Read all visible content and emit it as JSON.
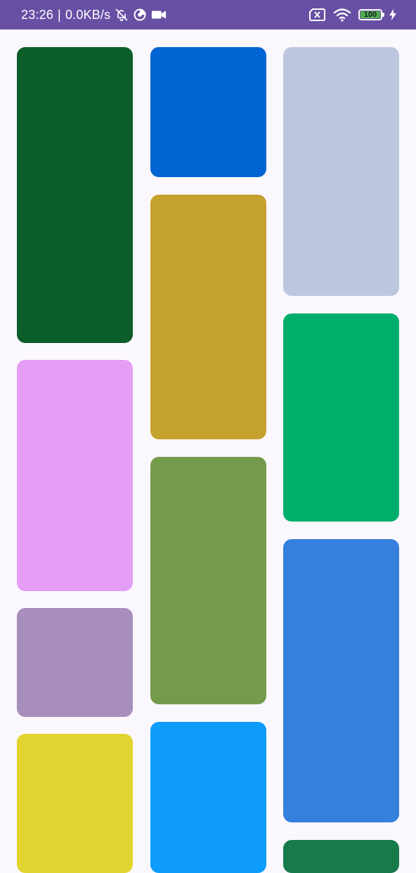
{
  "status_bar": {
    "time": "23:26",
    "separator": "|",
    "network_speed": "0.0KB/s",
    "battery_level": "100",
    "background": "#6750a4",
    "icons": [
      "bell-off-icon",
      "data-saver-icon",
      "video-camera-icon",
      "sim-none-icon",
      "wifi-icon",
      "battery-icon",
      "charging-bolt-icon"
    ]
  },
  "grid": {
    "columns": [
      {
        "tiles": [
          {
            "color": "#0b5e2a"
          },
          {
            "color": "#e49ef6"
          },
          {
            "color": "#a88ebd"
          },
          {
            "color": "#e2d430"
          }
        ]
      },
      {
        "tiles": [
          {
            "color": "#0064d2"
          },
          {
            "color": "#c5a12e"
          },
          {
            "color": "#749a4c"
          },
          {
            "color": "#0d9cfc"
          }
        ]
      },
      {
        "tiles": [
          {
            "color": "#bcc7df"
          },
          {
            "color": "#00ae6c"
          },
          {
            "color": "#367fdd"
          },
          {
            "color": "#167a4b"
          }
        ]
      }
    ]
  }
}
